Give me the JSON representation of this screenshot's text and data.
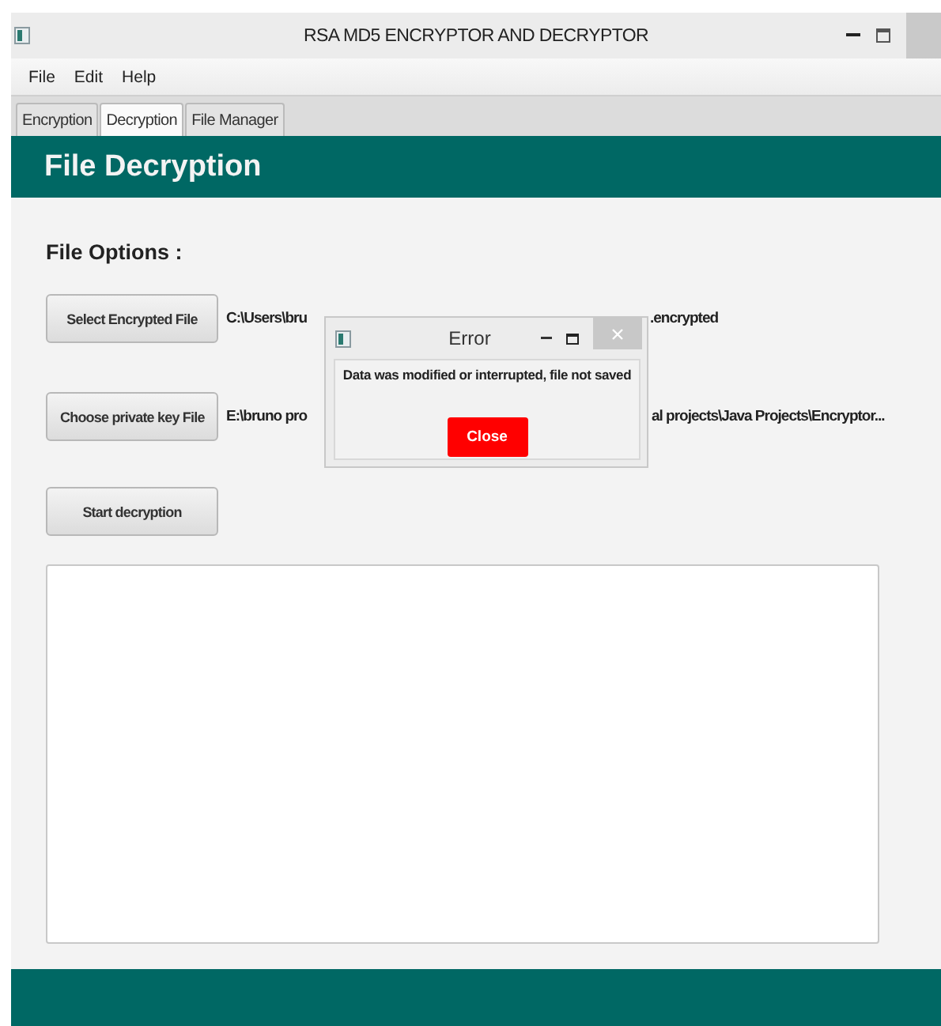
{
  "window": {
    "title": "RSA MD5 ENCRYPTOR AND DECRYPTOR"
  },
  "menu": [
    "File",
    "Edit",
    "Help"
  ],
  "tabs": [
    {
      "label": "Encryption",
      "selected": false
    },
    {
      "label": "Decryption",
      "selected": true
    },
    {
      "label": "File Manager",
      "selected": false
    }
  ],
  "header": "File Decryption",
  "section_title": "File Options :",
  "file_rows": [
    {
      "button": "Select Encrypted File",
      "path_start": "C:\\Users\\bru",
      "path_end": ".encrypted"
    },
    {
      "button": "Choose private key File",
      "path_start": "E:\\bruno pro",
      "path_end": "al projects\\Java Projects\\Encryptor..."
    }
  ],
  "start_button": "Start decryption",
  "dialog": {
    "title": "Error",
    "message": "Data was modified or interrupted, file not saved",
    "button": "Close"
  }
}
